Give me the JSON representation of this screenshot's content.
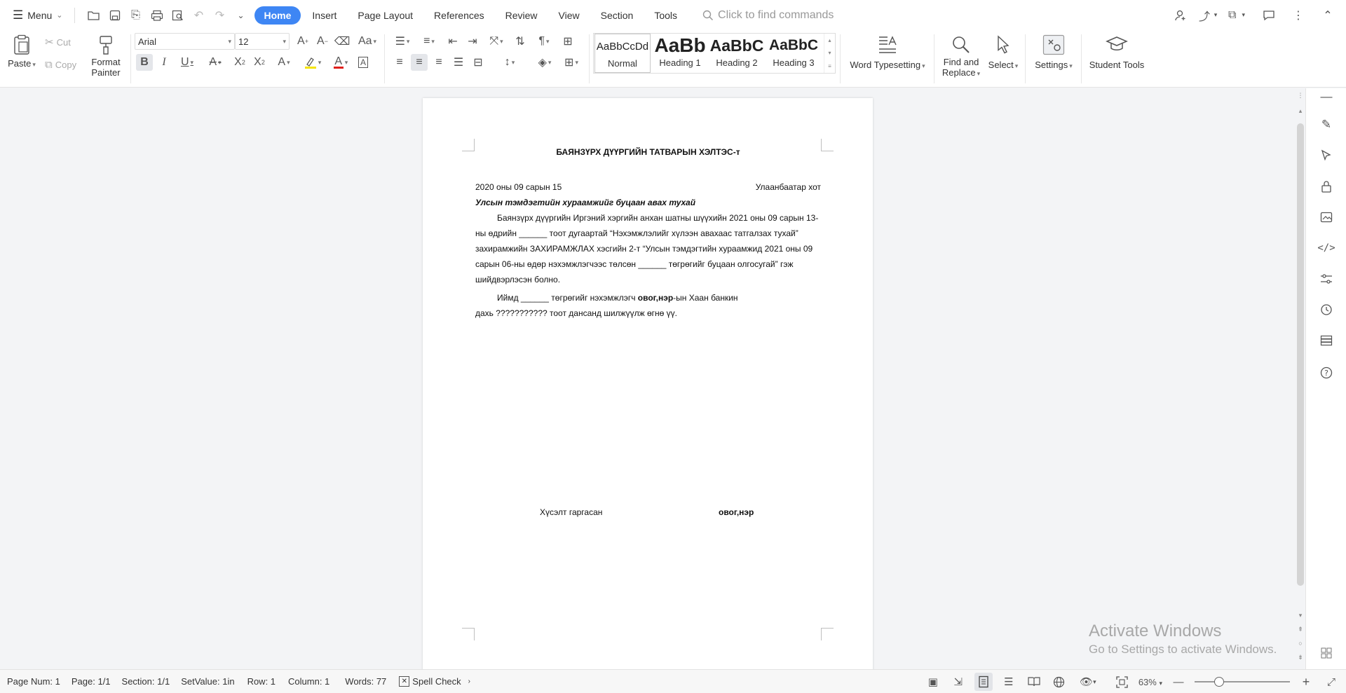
{
  "topbar": {
    "menu_label": "Menu",
    "tabs": [
      {
        "label": "Home",
        "active": true
      },
      {
        "label": "Insert"
      },
      {
        "label": "Page Layout"
      },
      {
        "label": "References"
      },
      {
        "label": "Review"
      },
      {
        "label": "View"
      },
      {
        "label": "Section"
      },
      {
        "label": "Tools"
      }
    ],
    "search_placeholder": "Click to find commands",
    "accent_color": "#3e86f4"
  },
  "ribbon": {
    "paste": "Paste",
    "cut": "Cut",
    "copy": "Copy",
    "format_painter_1": "Format",
    "format_painter_2": "Painter",
    "font_name": "Arial",
    "font_size": "12",
    "styles": {
      "normal_sample": "AaBbCcDd",
      "normal": "Normal",
      "h1_sample": "AaBb",
      "h1": "Heading 1",
      "h2_sample": "AaBbC",
      "h2": "Heading 2",
      "h3_sample": "AaBbC",
      "h3": "Heading 3"
    },
    "word_typesetting": "Word Typesetting",
    "find_replace_1": "Find and",
    "find_replace_2": "Replace",
    "select": "Select",
    "settings": "Settings",
    "student_tools": "Student Tools"
  },
  "document": {
    "title": "БАЯНЗҮРХ ДҮҮРГИЙН ТАТВАРЫН ХЭЛТЭС-т",
    "date": "2020 оны 09 сарын 15",
    "city": "Улаанбаатар хот",
    "subject": "Улсын тэмдэгтийн хураамжийг буцаан авах тухай",
    "para1": "Баянзүрх дүүргийн Иргэний хэргийн анхан шатны шүүхийн 2021 оны 09 сарын 13-ны өдрийн ______ тоот дугаартай “Нэхэмжлэлийг хүлээн авахаас татгалзах тухай” захирамжийн ЗАХИРАМЖЛАХ хэсгийн 2-т “Улсын тэмдэгтийн хураамжид 2021 оны 09 сарын 06-ны өдөр нэхэмжлэгчээс төлсөн ______ төгрөгийг буцаан олгосугай” гэж шийдвэрлэсэн болно.",
    "para2_a": "Иймд ______ төгрөгийг нэхэмжлэгч ",
    "para2_b": "овог,нэр",
    "para2_c": "-ын Хаан банкин",
    "para2_d": "дахь ??????????? тоот дансанд шилжүүлж өгнө үү.",
    "sign_label": "Хүсэлт гаргасан",
    "sign_name": "овог,нэр"
  },
  "watermark": {
    "line1": "Activate Windows",
    "line2": "Go to Settings to activate Windows."
  },
  "statusbar": {
    "page_num": "Page Num: 1",
    "page": "Page: 1/1",
    "section": "Section: 1/1",
    "setvalue": "SetValue: 1in",
    "row": "Row: 1",
    "column": "Column: 1",
    "words": "Words: 77",
    "spell_check": "Spell Check",
    "zoom": "63%",
    "zoom_percent": 63
  }
}
